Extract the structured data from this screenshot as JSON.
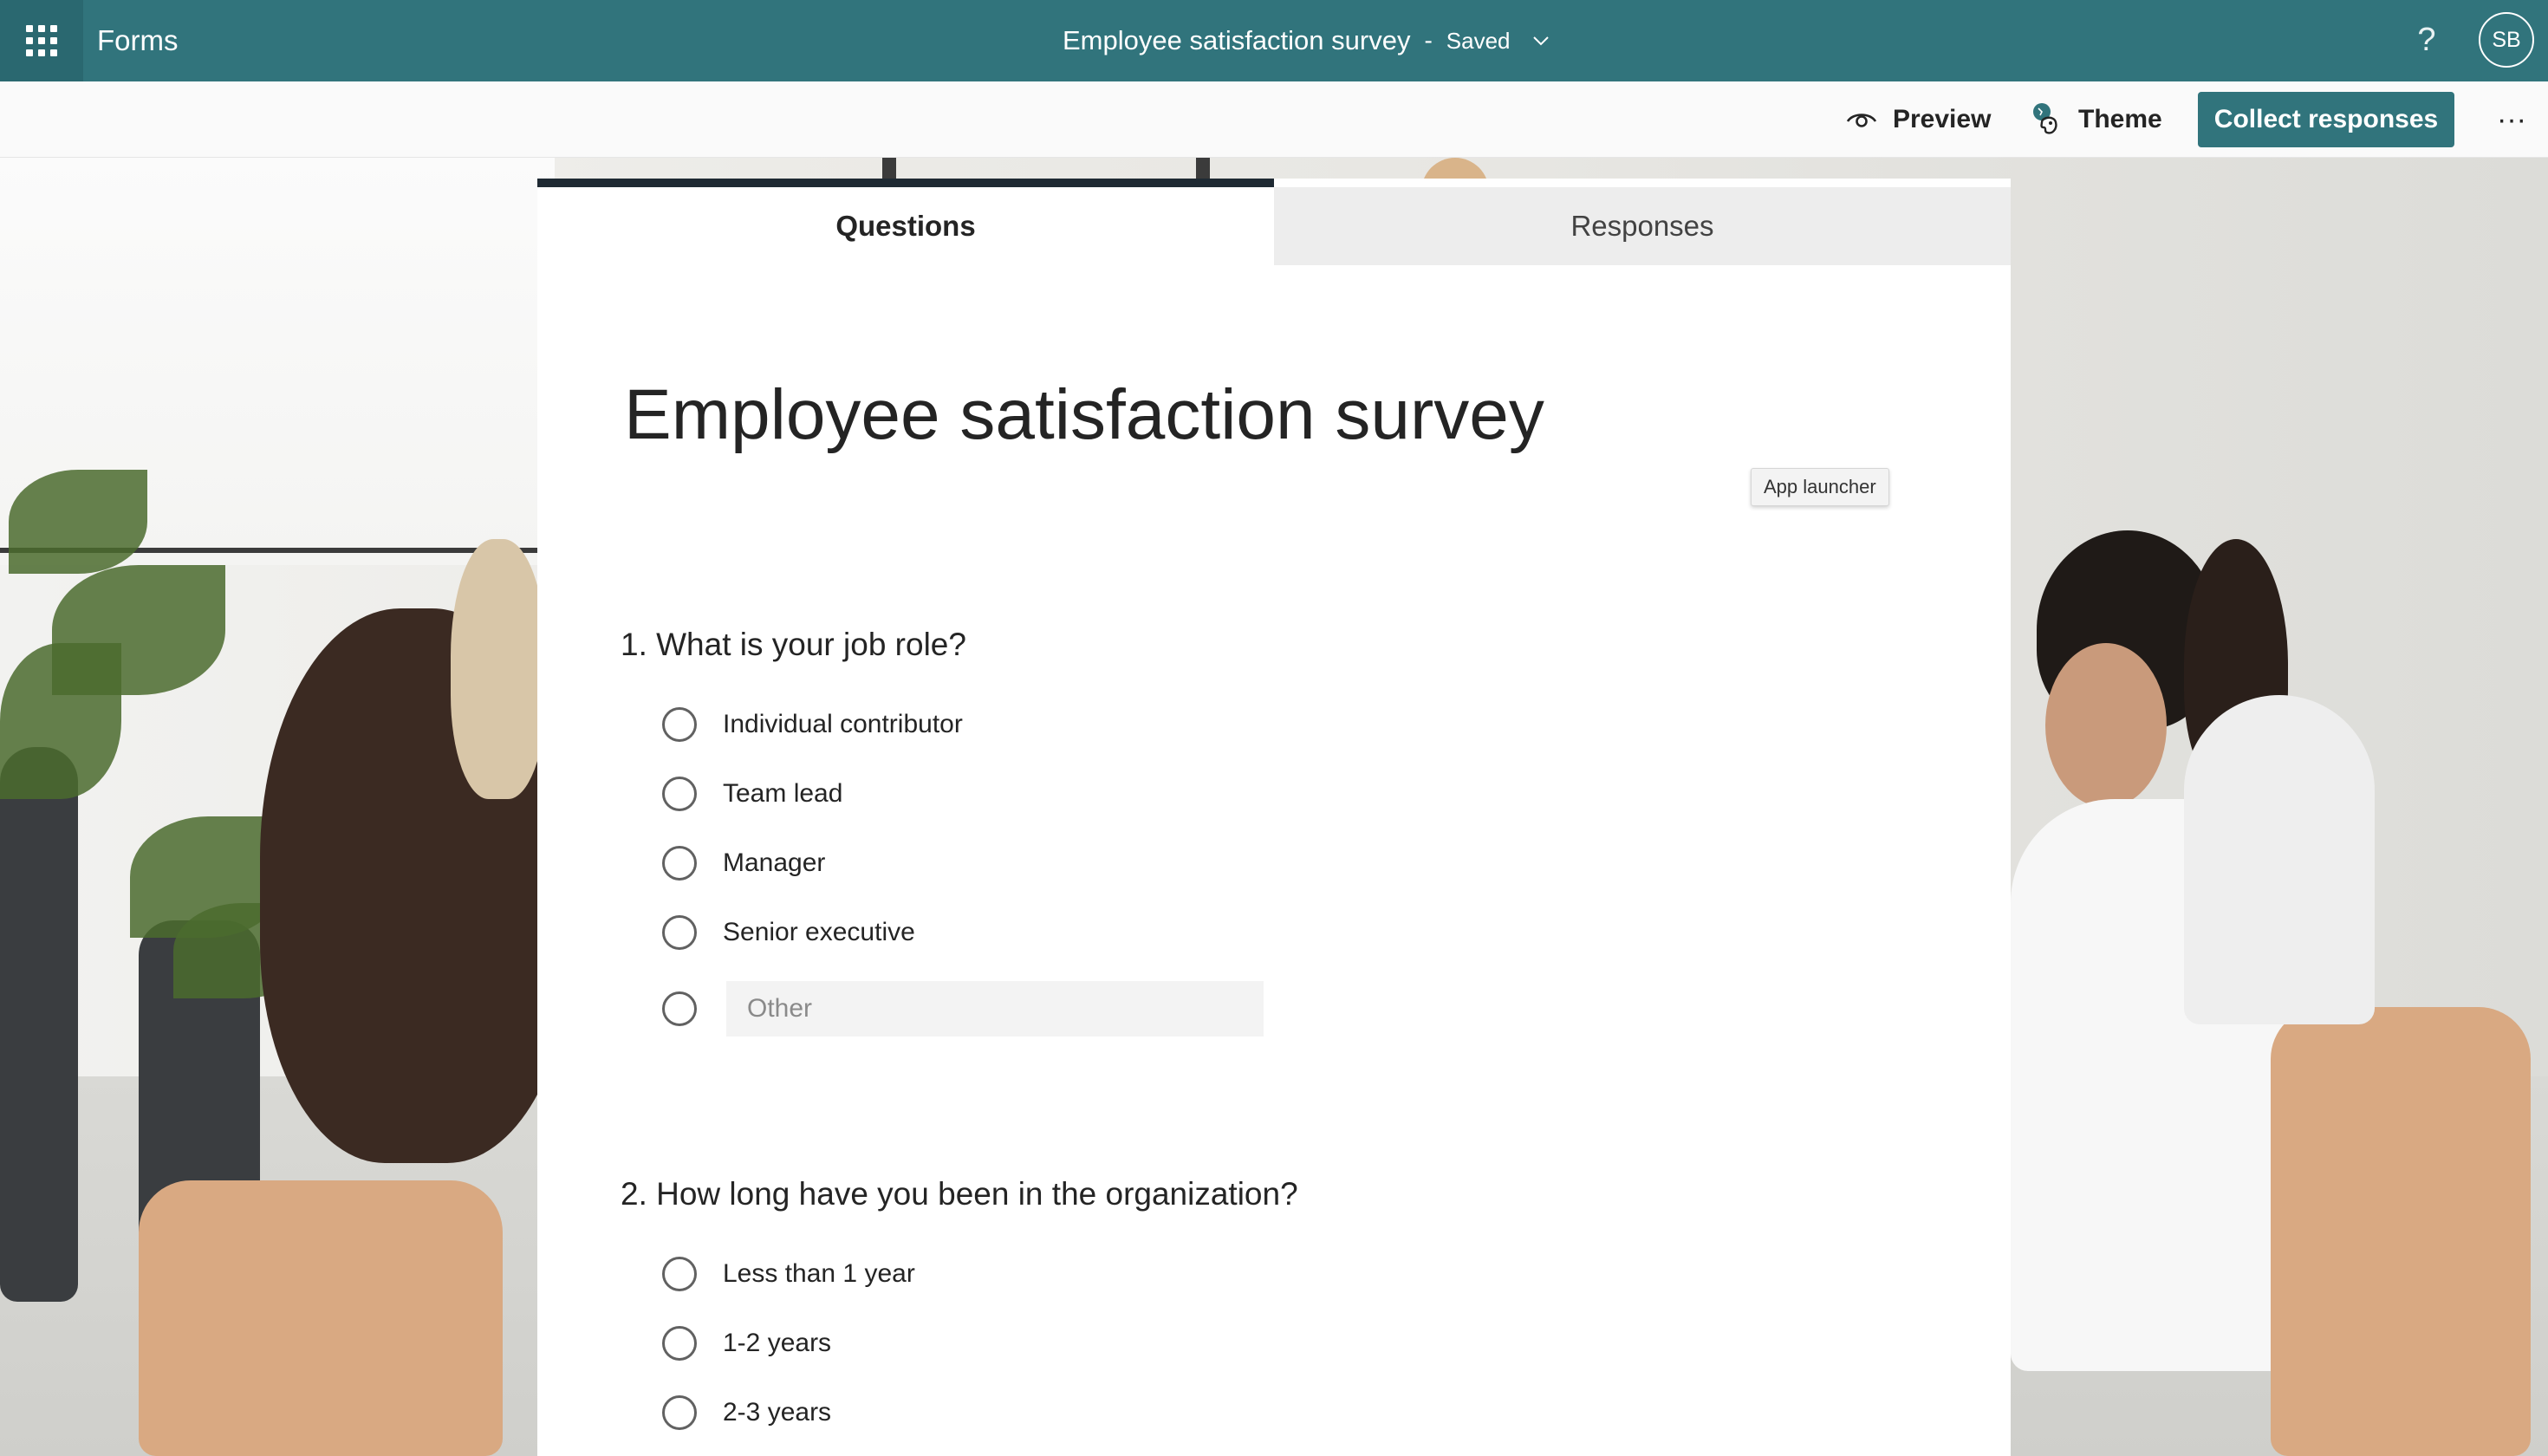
{
  "app": {
    "name": "Forms",
    "doc_title": "Employee satisfaction survey",
    "separator": "-",
    "save_status": "Saved",
    "help_symbol": "?",
    "user_initials": "SB"
  },
  "toolbar": {
    "preview_label": "Preview",
    "theme_label": "Theme",
    "collect_label": "Collect responses",
    "more_symbol": "···"
  },
  "tabs": {
    "questions": "Questions",
    "responses": "Responses"
  },
  "form": {
    "title": "Employee satisfaction survey",
    "tooltip": "App launcher",
    "questions": [
      {
        "title": "1. What is your job role?",
        "options": [
          "Individual contributor",
          "Team lead",
          "Manager",
          "Senior executive"
        ],
        "other_placeholder": "Other"
      },
      {
        "title": "2. How long have you been in the organization?",
        "options": [
          "Less than 1 year",
          "1-2 years",
          "2-3 years"
        ]
      }
    ]
  },
  "colors": {
    "brand": "#31747c",
    "active_tab_bar": "#1f2a33"
  },
  "icons": [
    "app-launcher-icon",
    "chevron-down-icon",
    "help-icon",
    "eye-icon",
    "palette-icon",
    "more-icon"
  ]
}
